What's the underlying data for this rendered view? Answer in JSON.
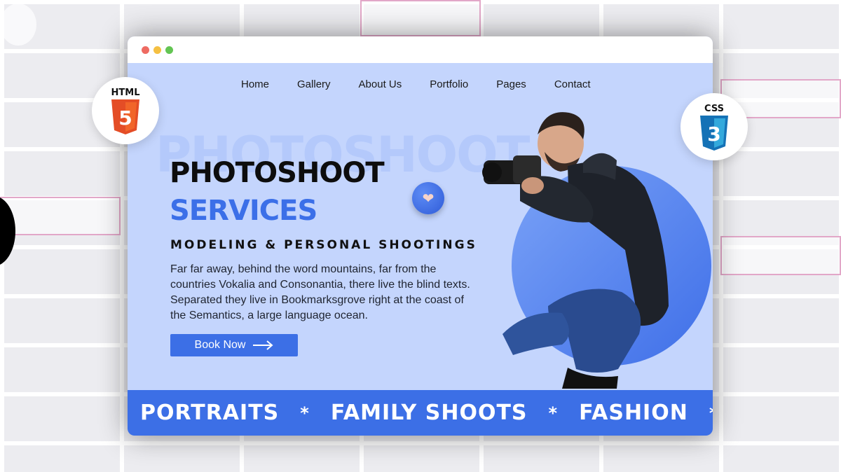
{
  "nav": {
    "items": [
      "Home",
      "Gallery",
      "About Us",
      "Portfolio",
      "Pages",
      "Contact"
    ]
  },
  "hero": {
    "background_word": "PHOTOSHOOT",
    "title_line1": "PHOTOSHOOT",
    "title_line2": "SERVICES",
    "subtitle": "MODELING & PERSONAL SHOOTINGS",
    "description": "Far far away, behind the word mountains, far from the countries Vokalia and Consonantia, there live the blind texts. Separated they live in Bookmarksgrove right at the coast of the Semantics, a large language ocean.",
    "button_label": "Book Now",
    "button_icon": "arrow-right-icon"
  },
  "ribbon": {
    "items": [
      "PORTRAITS",
      "FAMILY SHOOTS",
      "FASHION"
    ],
    "separator": "*"
  },
  "badges": {
    "html_label": "HTML",
    "html_number": "5",
    "css_label": "CSS",
    "css_number": "3"
  },
  "colors": {
    "accent": "#3c6fe6",
    "hero_bg": "#c4d5fd",
    "html_orange": "#e44d26",
    "css_blue": "#2965f1"
  }
}
